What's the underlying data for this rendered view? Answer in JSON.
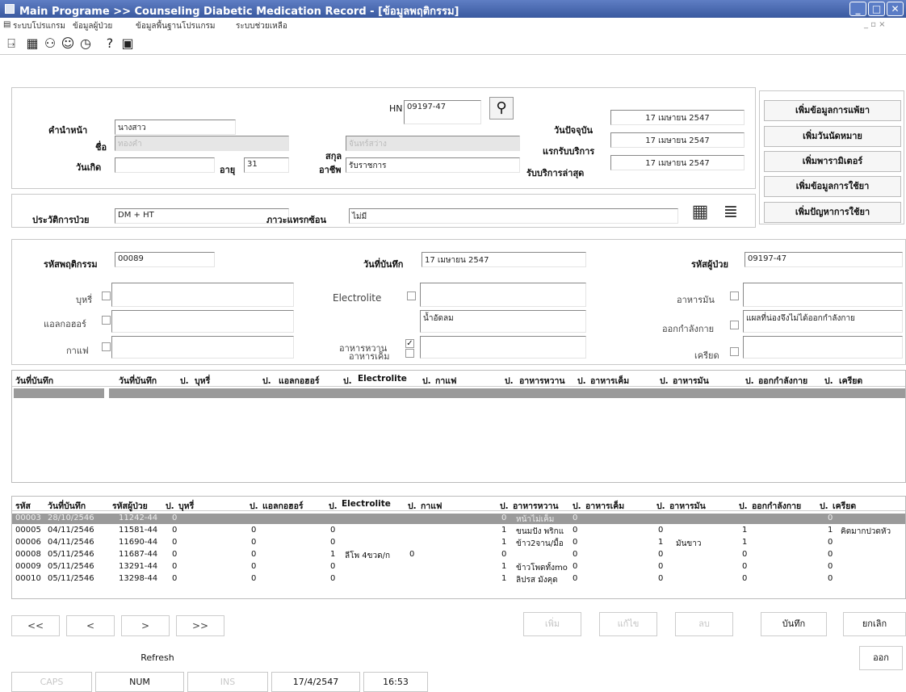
{
  "window": {
    "title": "Main Programe >> Counseling Diabetic Medication Record - [ข้อมูลพฤติกรรม]",
    "minimize": "_",
    "maximize": "□",
    "close": "✕",
    "mdi_controls": "_  ▫  ×"
  },
  "menu": [
    "ระบบโปรแกรม",
    "ข้อมูลผู้ป่วย",
    "ข้อมูลพื้นฐานโปรแกรม",
    "ระบบช่วยเหลือ"
  ],
  "patient": {
    "hn_label": "HN",
    "hn": "09197-47",
    "prefix_label": "คำนำหน้า",
    "prefix": "นางสาว",
    "name_label": "ชื่อ",
    "name": "ทองคำ",
    "surname_label": "สกุล",
    "surname": "จันทร์สว่าง",
    "birth_label": "วันเกิด",
    "birth": "",
    "age_label": "อายุ",
    "age": "31",
    "job_label": "อาชีพ",
    "job": "รับราชการ",
    "today_label": "วันปัจจุบัน",
    "today": "17 เมษายน 2547",
    "first_service_label": "แรกรับบริการ",
    "first_service": "17 เมษายน 2547",
    "last_service_label": "รับบริการล่าสุด",
    "last_service": "17 เมษายน 2547",
    "history_label": "ประวัติการป่วย",
    "history": "DM + HT",
    "complication_label": "ภาวะแทรกซ้อน",
    "complication": "ไม่มี"
  },
  "side_buttons": [
    "เพิ่มข้อมูลการแพ้ยา",
    "เพิ่มวันนัดหมาย",
    "เพิ่มพารามิเตอร์",
    "เพิ่มข้อมูลการใช้ยา",
    "เพิ่มปัญหาการใช้ยา"
  ],
  "behavior": {
    "code_label": "รหัสพฤติกรรม",
    "code": "00089",
    "date_label": "วันที่บันทึก",
    "date": "17 เมษายน 2547",
    "patient_code_label": "รหัสผู้ป่วย",
    "patient_code": "09197-47",
    "smoke_label": "บุหรี่",
    "alcohol_label": "แอลกอฮอร์",
    "coffee_label": "กาแฟ",
    "electrolite_label": "Electrolite",
    "sweet_label": "อาหารหวาน",
    "sweet_value": "น้ำอัดลม",
    "sweet_checked": "✓",
    "salty_label": "อาหารเค็ม",
    "fat_label": "อาหารมัน",
    "exercise_label": "ออกกำลังกาย",
    "exercise_value": "แผลที่น่องจึงไม่ได้ออกกำลังกาย",
    "stress_label": "เครียด"
  },
  "grid1": {
    "side_header": "วันที่บันทึก",
    "columns": [
      "วันที่บันทึก",
      "ป.",
      "บุหรี่",
      "ป.",
      "แอลกอฮอร์",
      "ป.",
      "Electrolite",
      "ป.",
      "กาแฟ",
      "ป.",
      "อาหารหวาน",
      "ป.",
      "อาหารเค็ม",
      "ป.",
      "อาหารมัน",
      "ป.",
      "ออกกำลังกาย",
      "ป.",
      "เครียด"
    ]
  },
  "grid2": {
    "columns": [
      "รหัส",
      "วันที่บันทึก",
      "รหัสผู้ป่วย",
      "ป.",
      "บุหรี่",
      "ป.",
      "แอลกอฮอร์",
      "ป.",
      "Electrolite",
      "ป.",
      "กาแฟ",
      "ป.",
      "อาหารหวาน",
      "ป.",
      "อาหารเค็ม",
      "ป.",
      "อาหารมัน",
      "ป.",
      "ออกกำลังกาย",
      "ป.",
      "เครียด"
    ],
    "rows": [
      {
        "code": "00003",
        "date": "28/10/2546",
        "pid": "11242-44",
        "p1": "0",
        "p2": "",
        "p3": "",
        "elec": "",
        "p4": "",
        "p5": "0",
        "sweet": "หน้าไม่เค็ม",
        "p6": "0",
        "p7": "",
        "fat": "",
        "p8": "",
        "p9": "0",
        "stress": ""
      },
      {
        "code": "00005",
        "date": "04/11/2546",
        "pid": "11581-44",
        "p1": "0",
        "p2": "0",
        "p3": "0",
        "elec": "",
        "p4": "",
        "p5": "1",
        "sweet": "ขนมปัง พริกแ",
        "p6": "0",
        "p7": "0",
        "fat": "",
        "p8": "1",
        "p9": "1",
        "stress": "คิดมากปวดหัว"
      },
      {
        "code": "00006",
        "date": "04/11/2546",
        "pid": "11690-44",
        "p1": "0",
        "p2": "0",
        "p3": "0",
        "elec": "",
        "p4": "",
        "p5": "1",
        "sweet": "ข้าว2จาน/มื้อ",
        "p6": "0",
        "p7": "1",
        "fat": "มันขาว",
        "p8": "1",
        "p9": "0",
        "stress": ""
      },
      {
        "code": "00008",
        "date": "05/11/2546",
        "pid": "11687-44",
        "p1": "0",
        "p2": "0",
        "p3": "1",
        "elec": "ลีโพ 4ขวด/ก",
        "p4": "0",
        "p5": "0",
        "sweet": "",
        "p6": "0",
        "p7": "0",
        "fat": "",
        "p8": "0",
        "p9": "0",
        "stress": ""
      },
      {
        "code": "00009",
        "date": "05/11/2546",
        "pid": "13291-44",
        "p1": "0",
        "p2": "0",
        "p3": "0",
        "elec": "",
        "p4": "",
        "p5": "1",
        "sweet": "ข้าวโพดทั้งmo",
        "p6": "0",
        "p7": "0",
        "fat": "",
        "p8": "0",
        "p9": "0",
        "stress": ""
      },
      {
        "code": "00010",
        "date": "05/11/2546",
        "pid": "13298-44",
        "p1": "0",
        "p2": "0",
        "p3": "0",
        "elec": "",
        "p4": "",
        "p5": "1",
        "sweet": "ลิปรส มังคุด",
        "p6": "0",
        "p7": "0",
        "fat": "",
        "p8": "0",
        "p9": "0",
        "stress": ""
      }
    ]
  },
  "nav": [
    "<<",
    "<",
    ">",
    ">>"
  ],
  "actions": {
    "add": "เพิ่ม",
    "edit": "แก้ไข",
    "delete": "ลบ",
    "save": "บันทึก",
    "cancel": "ยกเลิก",
    "refresh": "Refresh",
    "exit": "ออก"
  },
  "statusbar": {
    "caps": "CAPS",
    "num": "NUM",
    "ins": "INS",
    "date": "17/4/2547",
    "time": "16:53"
  }
}
